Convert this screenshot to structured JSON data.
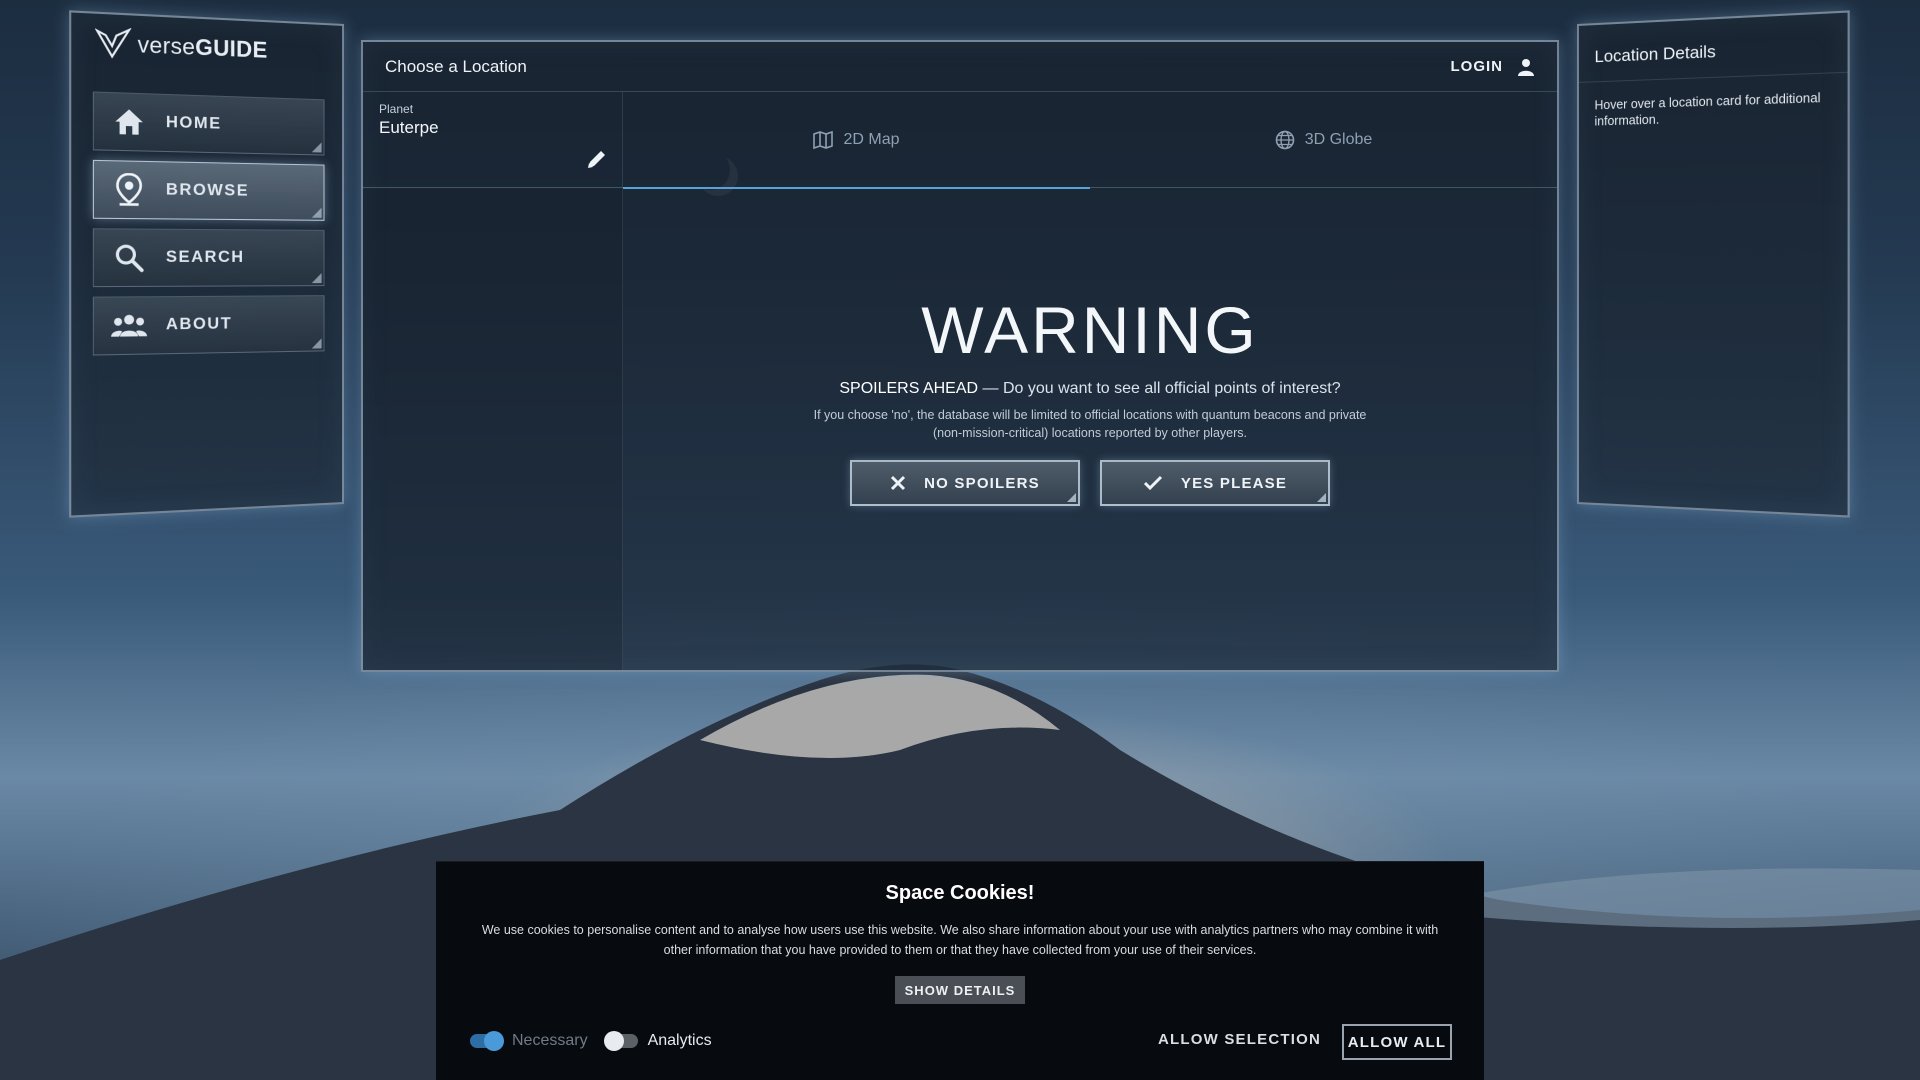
{
  "app": {
    "logo_prefix": "verse",
    "logo_suffix": "GUIDE"
  },
  "sidebar": {
    "items": [
      {
        "label": "HOME",
        "icon": "home-icon"
      },
      {
        "label": "BROWSE",
        "icon": "map-pin-icon",
        "active": true
      },
      {
        "label": "SEARCH",
        "icon": "search-icon"
      },
      {
        "label": "ABOUT",
        "icon": "users-icon"
      }
    ]
  },
  "main": {
    "title": "Choose a Location",
    "login_label": "LOGIN",
    "planet_label": "Planet",
    "planet_value": "Euterpe",
    "tabs": [
      {
        "label": "2D Map",
        "icon": "map-icon",
        "active": true
      },
      {
        "label": "3D Globe",
        "icon": "globe-icon",
        "active": false
      }
    ],
    "warning": {
      "title": "WARNING",
      "question_strong": "SPOILERS AHEAD",
      "question_rest": " — Do you want to see all official points of interest?",
      "note": "If you choose 'no', the database will be limited to official locations with quantum beacons and private (non-mission-critical) locations reported by other players.",
      "no_label": "NO SPOILERS",
      "yes_label": "YES PLEASE"
    }
  },
  "details": {
    "title": "Location Details",
    "hint": "Hover over a location card for additional information."
  },
  "cookies": {
    "title": "Space Cookies!",
    "text": "We use cookies to personalise content and to analyse how users use this website. We also share information about your use with analytics partners who may combine it with other information that you have provided to them or that they have collected from your use of their services.",
    "show_details": "SHOW DETAILS",
    "necessary_label": "Necessary",
    "analytics_label": "Analytics",
    "necessary_on": true,
    "analytics_on": false,
    "allow_selection": "ALLOW SELECTION",
    "allow_all": "ALLOW ALL"
  },
  "colors": {
    "accent": "#5aa0d8",
    "toggle_on": "#2d6da3"
  }
}
